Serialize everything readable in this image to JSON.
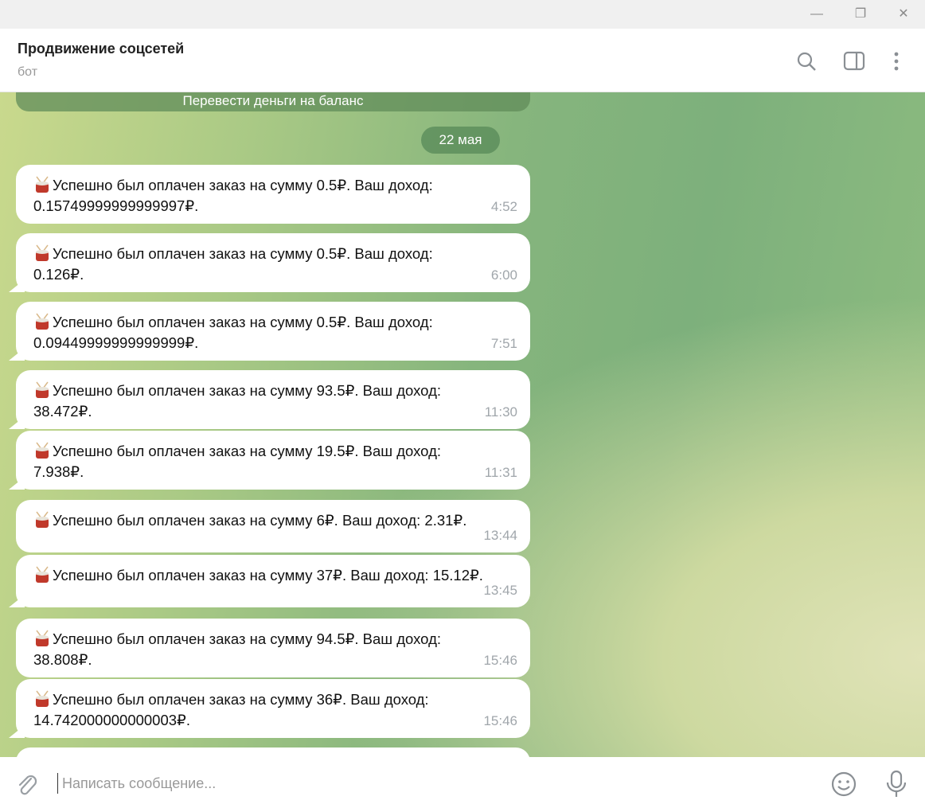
{
  "window": {
    "controls": [
      "minimize",
      "restore",
      "close"
    ]
  },
  "header": {
    "title": "Продвижение соцсетей",
    "subtitle": "бот"
  },
  "chat": {
    "top_button_label": "Перевести деньги на баланс",
    "date_badge": "22 мая",
    "messages": [
      {
        "icon": "drum",
        "line1": "Успешно был оплачен заказ на сумму 0.5₽. Ваш доход:",
        "line2": "0.15749999999999997₽.",
        "time": "4:52"
      },
      {
        "icon": "drum",
        "line1": "Успешно был оплачен заказ на сумму 0.5₽. Ваш доход:",
        "line2": "0.126₽.",
        "time": "6:00"
      },
      {
        "icon": "drum",
        "line1": "Успешно был оплачен заказ на сумму 0.5₽. Ваш доход:",
        "line2": "0.09449999999999999₽.",
        "time": "7:51"
      },
      {
        "icon": "drum",
        "line1": "Успешно был оплачен заказ на сумму 93.5₽. Ваш доход:",
        "line2": "38.472₽.",
        "time": "11:30"
      },
      {
        "icon": "drum",
        "line1": "Успешно был оплачен заказ на сумму 19.5₽. Ваш доход:",
        "line2": "7.938₽.",
        "time": "11:31"
      },
      {
        "icon": "drum",
        "line1": "Успешно был оплачен заказ на сумму 6₽. Ваш доход: 2.31₽.",
        "line2": "",
        "time": "13:44"
      },
      {
        "icon": "drum",
        "line1": "Успешно был оплачен заказ на сумму 37₽. Ваш доход: 15.12₽.",
        "line2": "",
        "time": "13:45"
      },
      {
        "icon": "drum",
        "line1": "Успешно был оплачен заказ на сумму 94.5₽. Ваш доход:",
        "line2": "38.808₽.",
        "time": "15:46"
      },
      {
        "icon": "drum",
        "line1": "Успешно был оплачен заказ на сумму 36₽. Ваш доход:",
        "line2": "14.742000000000003₽.",
        "time": "15:46"
      }
    ]
  },
  "composer": {
    "placeholder": "Написать сообщение..."
  }
}
